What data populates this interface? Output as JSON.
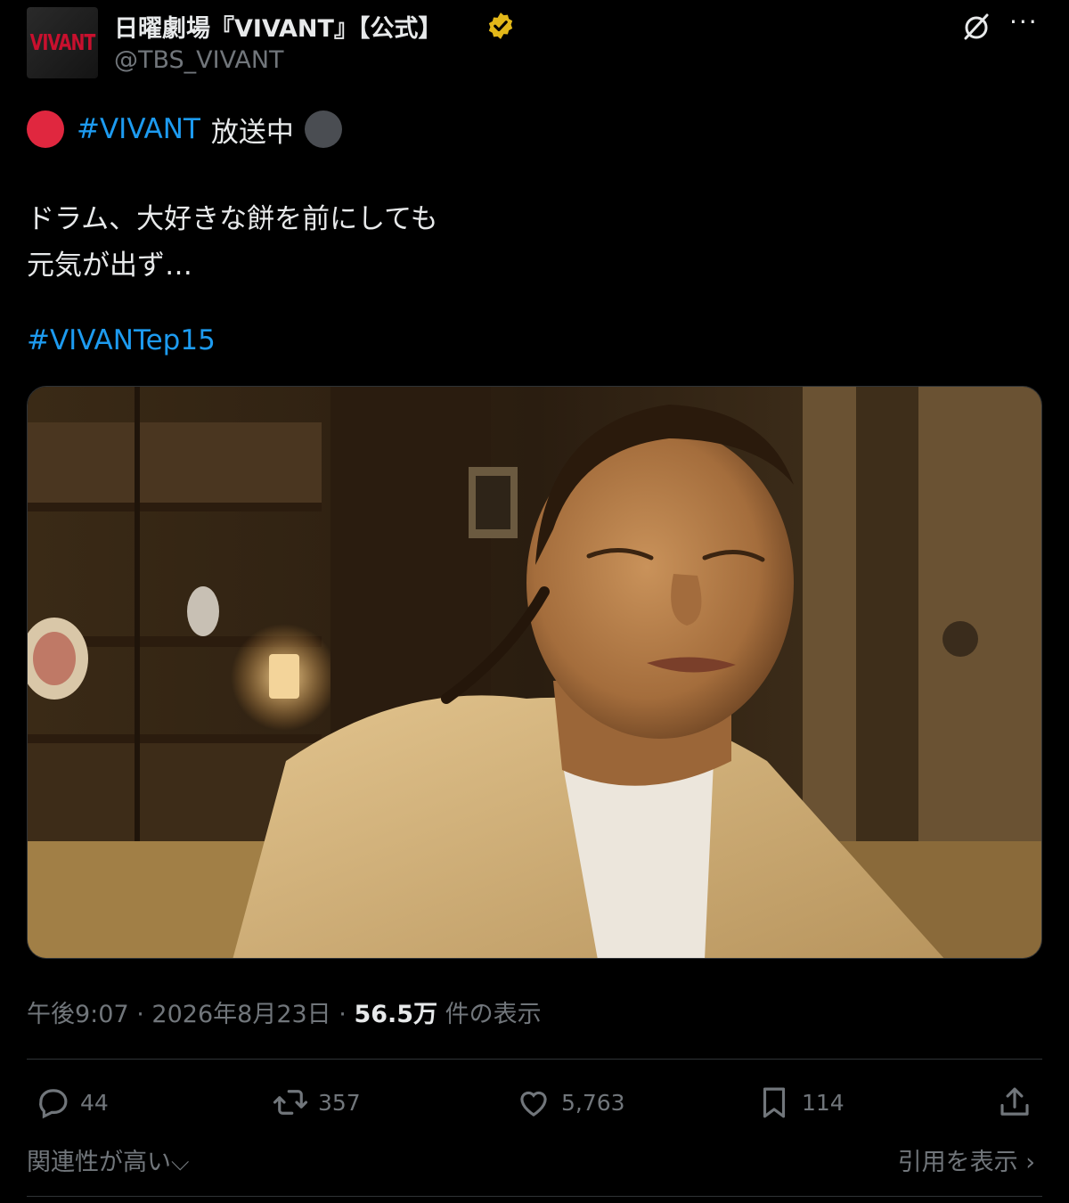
{
  "author": {
    "display_name": "日曜劇場『VIVANT』【公式】",
    "handle": "@TBS_VIVANT",
    "avatar_text": "VIVANT",
    "verified_color": "#e2b719"
  },
  "header_icons": {
    "grok": "grok-icon",
    "more": "···"
  },
  "tweet": {
    "hashtag1": "#VIVANT",
    "onair": "放送中",
    "body_line1": "ドラム、大好きな餅を前にしても",
    "body_line2": "元気が出ず…",
    "hashtag2": "#VIVANTep15"
  },
  "media": {
    "type": "photo"
  },
  "meta": {
    "time": "午後9:07",
    "sep1": "·",
    "date": "2026年8月23日",
    "sep2": "·",
    "views_count": "56.5万",
    "views_label": "件の表示"
  },
  "actions": {
    "reply_count": "44",
    "retweet_count": "357",
    "like_count": "5,763",
    "bookmark_count": "114"
  },
  "footer": {
    "sort_label": "関連性が高い",
    "quotes_label": "引用を表示"
  },
  "colors": {
    "accent": "#1d9bf0",
    "muted": "#71767b",
    "text": "#e7e9ea",
    "live_red": "#e0273f"
  }
}
